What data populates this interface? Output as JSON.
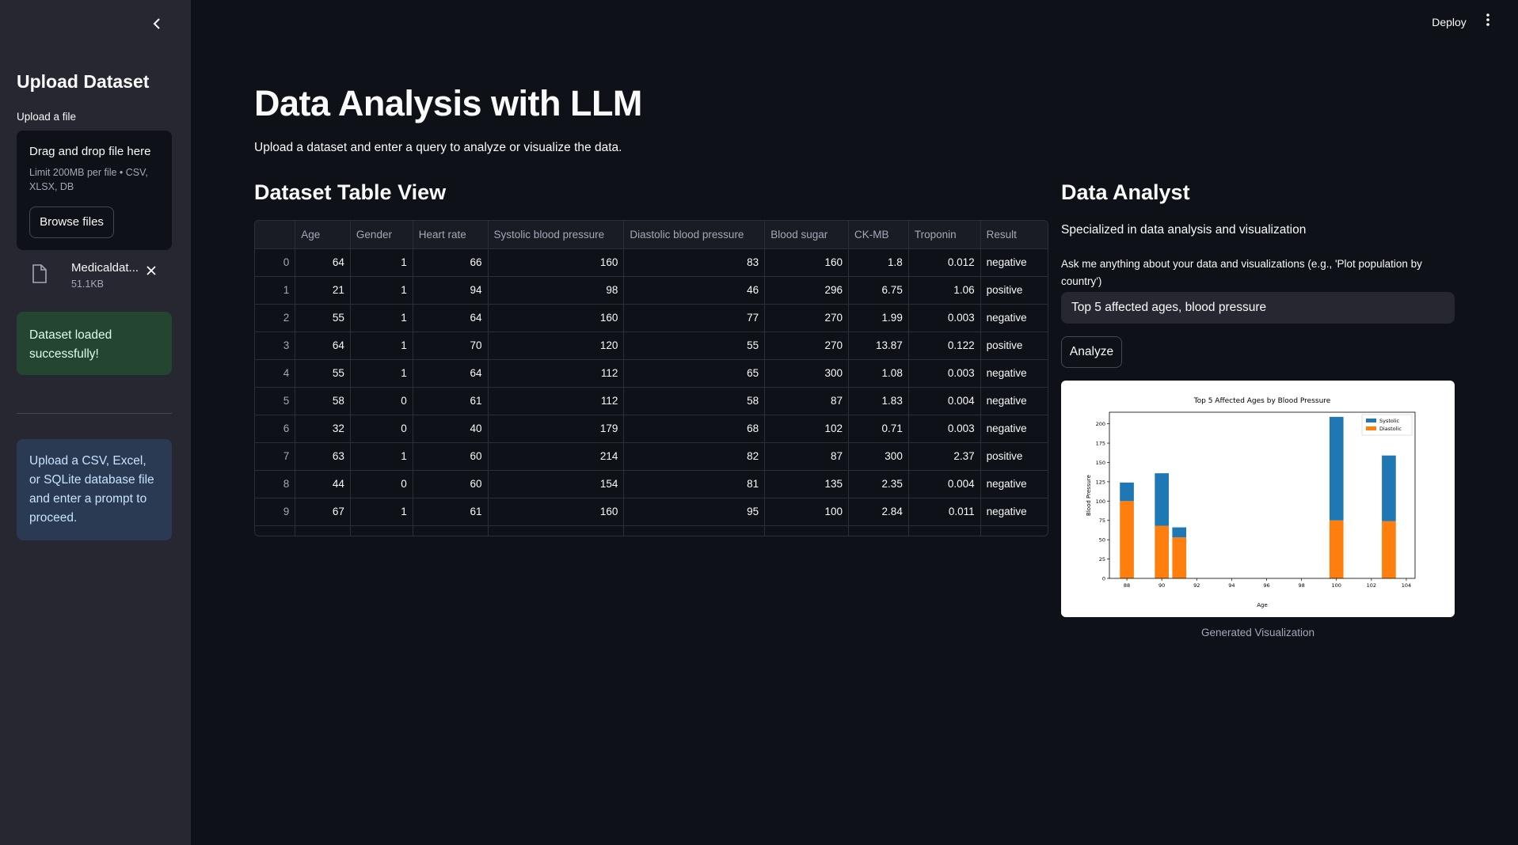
{
  "sidebar": {
    "collapse_icon": "chevron-left-icon",
    "title": "Upload Dataset",
    "upload_label": "Upload a file",
    "dropzone_title": "Drag and drop file here",
    "dropzone_limit": "Limit 200MB per file • CSV, XLSX, DB",
    "browse_label": "Browse files",
    "file_name": "Medicaldat...",
    "file_size": "51.1KB",
    "success_message": "Dataset loaded successfully!",
    "info_message": "Upload a CSV, Excel, or SQLite database file and enter a prompt to proceed."
  },
  "header": {
    "deploy_label": "Deploy",
    "menu_icon": "vertical-dots-icon"
  },
  "main": {
    "title": "Data Analysis with LLM",
    "subtitle": "Upload a dataset and enter a query to analyze or visualize the data.",
    "table_title": "Dataset Table View",
    "table": {
      "columns": [
        "",
        "Age",
        "Gender",
        "Heart rate",
        "Systolic blood pressure",
        "Diastolic blood pressure",
        "Blood sugar",
        "CK-MB",
        "Troponin",
        "Result"
      ],
      "rows": [
        [
          "0",
          "64",
          "1",
          "66",
          "160",
          "83",
          "160",
          "1.8",
          "0.012",
          "negative"
        ],
        [
          "1",
          "21",
          "1",
          "94",
          "98",
          "46",
          "296",
          "6.75",
          "1.06",
          "positive"
        ],
        [
          "2",
          "55",
          "1",
          "64",
          "160",
          "77",
          "270",
          "1.99",
          "0.003",
          "negative"
        ],
        [
          "3",
          "64",
          "1",
          "70",
          "120",
          "55",
          "270",
          "13.87",
          "0.122",
          "positive"
        ],
        [
          "4",
          "55",
          "1",
          "64",
          "112",
          "65",
          "300",
          "1.08",
          "0.003",
          "negative"
        ],
        [
          "5",
          "58",
          "0",
          "61",
          "112",
          "58",
          "87",
          "1.83",
          "0.004",
          "negative"
        ],
        [
          "6",
          "32",
          "0",
          "40",
          "179",
          "68",
          "102",
          "0.71",
          "0.003",
          "negative"
        ],
        [
          "7",
          "63",
          "1",
          "60",
          "214",
          "82",
          "87",
          "300",
          "2.37",
          "positive"
        ],
        [
          "8",
          "44",
          "0",
          "60",
          "154",
          "81",
          "135",
          "2.35",
          "0.004",
          "negative"
        ],
        [
          "9",
          "67",
          "1",
          "61",
          "160",
          "95",
          "100",
          "2.84",
          "0.011",
          "negative"
        ]
      ]
    }
  },
  "analyst": {
    "title": "Data Analyst",
    "subtitle": "Specialized in data analysis and visualization",
    "query_label": "Ask me anything about your data and visualizations (e.g., 'Plot population by country')",
    "query_value": "Top 5 affected ages, blood pressure",
    "analyze_label": "Analyze",
    "chart_caption": "Generated Visualization"
  },
  "chart_data": {
    "type": "bar",
    "stacked": true,
    "title": "Top 5 Affected Ages by Blood Pressure",
    "xlabel": "Age",
    "ylabel": "Blood Pressure",
    "xlim": [
      87,
      104.5
    ],
    "ylim": [
      0,
      215
    ],
    "x_ticks": [
      88,
      90,
      92,
      94,
      96,
      98,
      100,
      102,
      104
    ],
    "y_ticks": [
      0,
      25,
      50,
      75,
      100,
      125,
      150,
      175,
      200
    ],
    "x": [
      88,
      90,
      91,
      100,
      103
    ],
    "series": [
      {
        "name": "Diastolic",
        "color": "#ff7f0e",
        "values": [
          100,
          68,
          53,
          75,
          74
        ]
      },
      {
        "name": "Systolic",
        "color": "#1f77b4",
        "values": [
          24,
          68,
          13,
          134,
          85
        ]
      }
    ],
    "legend_position": "top-right",
    "grid": false
  },
  "colors": {
    "background": "#0e1117",
    "sidebar": "#262730",
    "success": "#24452f",
    "info": "#2a3a52"
  }
}
